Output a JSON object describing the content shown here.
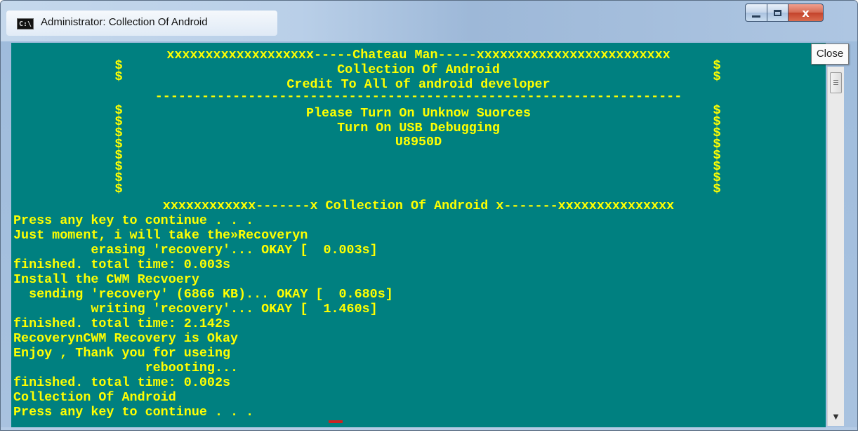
{
  "window": {
    "title": "Administrator:  Collection Of Android",
    "icon_label": "C:\\",
    "tooltip": "Close",
    "caption": {
      "close_label": "x"
    }
  },
  "console": {
    "banner_top": "xxxxxxxxxxxxxxxxxxx-----Chateau Man-----xxxxxxxxxxxxxxxxxxxxxxxxx",
    "title": "Collection Of Android",
    "credit": "Credit To All of android developer",
    "divider": "--------------------------------------------------------------------",
    "notice1": "Please Turn On Unknow Suorces",
    "notice2": "Turn On USB Debugging",
    "model": "U8950D",
    "dollar": "$",
    "banner_bottom": "xxxxxxxxxxxx-------x Collection Of Android x-------xxxxxxxxxxxxxxx",
    "lines": [
      "Press any key to continue . . .",
      "Just moment, i will take the»Recoveryn",
      "          erasing 'recovery'... OKAY [  0.003s]",
      "finished. total time: 0.003s",
      "Install the CWM Recvoery",
      "  sending 'recovery' (6866 KB)... OKAY [  0.680s]",
      "          writing 'recovery'... OKAY [  1.460s]",
      "finished. total time: 2.142s",
      "RecoverynCWM Recovery is Okay",
      "Enjoy , Thank you for useing",
      "                 rebooting...",
      "finished. total time: 0.002s",
      "Collection Of Android",
      "Press any key to continue . . ."
    ]
  },
  "colors": {
    "console_bg": "#008080",
    "console_text": "#ffff00",
    "cursor": "#cc2222"
  },
  "icons": [
    "cmd-icon",
    "minimize-icon",
    "maximize-icon",
    "close-icon",
    "scroll-down-arrow-icon"
  ]
}
